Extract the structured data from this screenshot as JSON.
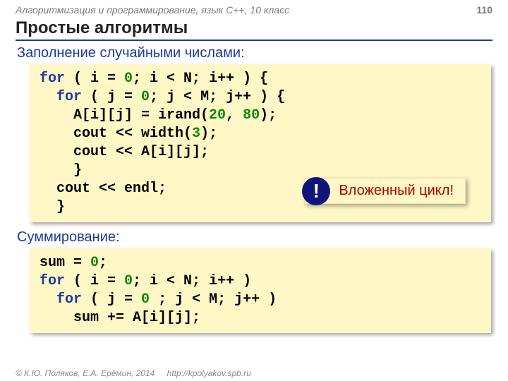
{
  "header": {
    "course": "Алгоритмизация и программирование, язык C++, 10 класс",
    "page": "110"
  },
  "title": "Простые алгоритмы",
  "section1": "Заполнение случайными числами:",
  "code1": {
    "tokens": [
      [
        [
          "kw",
          "for"
        ],
        [
          "",
          " ( i = "
        ],
        [
          "num",
          "0"
        ],
        [
          "",
          "; i < N; i++ ) {"
        ]
      ],
      [
        [
          "",
          "  "
        ],
        [
          "kw",
          "for"
        ],
        [
          "",
          " ( j = "
        ],
        [
          "num",
          "0"
        ],
        [
          "",
          "; j < M; j++ ) {"
        ]
      ],
      [
        [
          "",
          "    A[i][j] = irand("
        ],
        [
          "num",
          "20"
        ],
        [
          "",
          ", "
        ],
        [
          "num",
          "80"
        ],
        [
          "",
          ");"
        ]
      ],
      [
        [
          "",
          "    cout << width("
        ],
        [
          "num",
          "3"
        ],
        [
          "",
          ");"
        ]
      ],
      [
        [
          "",
          "    cout << A[i][j];"
        ]
      ],
      [
        [
          "",
          "    }"
        ]
      ],
      [
        [
          "",
          "  cout << endl;"
        ]
      ],
      [
        [
          "",
          "  }"
        ]
      ]
    ]
  },
  "badge": {
    "mark": "!",
    "text": "Вложенный цикл!"
  },
  "section2": "Суммирование:",
  "code2": {
    "tokens": [
      [
        [
          "",
          "sum = "
        ],
        [
          "num",
          "0"
        ],
        [
          "",
          ";"
        ]
      ],
      [
        [
          "kw",
          "for"
        ],
        [
          "",
          " ( i = "
        ],
        [
          "num",
          "0"
        ],
        [
          "",
          "; i < N; i++ )"
        ]
      ],
      [
        [
          "",
          "  "
        ],
        [
          "kw",
          "for"
        ],
        [
          "",
          " ( j = "
        ],
        [
          "num",
          "0"
        ],
        [
          "",
          " ; j < M; j++ )"
        ]
      ],
      [
        [
          "",
          "    sum += A[i][j];"
        ]
      ]
    ]
  },
  "footer": {
    "copyright": "© К.Ю. Поляков, Е.А. Ерёмин, 2014",
    "url": "http://kpolyakov.spb.ru"
  }
}
